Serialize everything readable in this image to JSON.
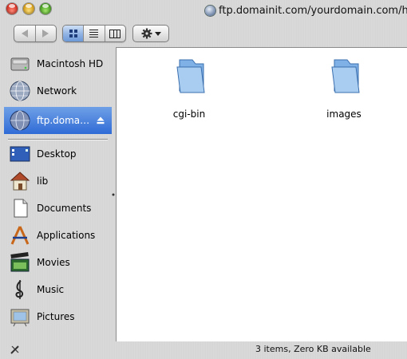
{
  "window": {
    "title": "ftp.domainit.com/yourdomain.com/htm"
  },
  "toolbar": {
    "back_icon": "back-arrow-icon",
    "forward_icon": "forward-arrow-icon",
    "views": [
      "icon-view-icon",
      "list-view-icon",
      "column-view-icon"
    ],
    "active_view": "icon-view",
    "action_icon": "gear-icon"
  },
  "sidebar": {
    "devices": [
      {
        "label": "Macintosh HD",
        "icon": "hard-disk-icon"
      },
      {
        "label": "Network",
        "icon": "network-globe-icon"
      },
      {
        "label": "ftp.doma…",
        "icon": "ftp-server-icon",
        "selected": true,
        "eject": "eject-icon"
      }
    ],
    "places": [
      {
        "label": "Desktop",
        "icon": "desktop-icon"
      },
      {
        "label": "lib",
        "icon": "home-icon"
      },
      {
        "label": "Documents",
        "icon": "documents-icon"
      },
      {
        "label": "Applications",
        "icon": "applications-icon"
      },
      {
        "label": "Movies",
        "icon": "movies-icon"
      },
      {
        "label": "Music",
        "icon": "music-icon"
      },
      {
        "label": "Pictures",
        "icon": "pictures-icon"
      }
    ]
  },
  "content": {
    "items": [
      {
        "name": "cgi-bin",
        "icon": "folder-icon"
      },
      {
        "name": "images",
        "icon": "folder-icon"
      }
    ]
  },
  "statusbar": {
    "text": "3 items, Zero KB available",
    "icon": "pencil-icon"
  },
  "colors": {
    "selection": "#3a78dc",
    "content_background": "#ffffff"
  }
}
